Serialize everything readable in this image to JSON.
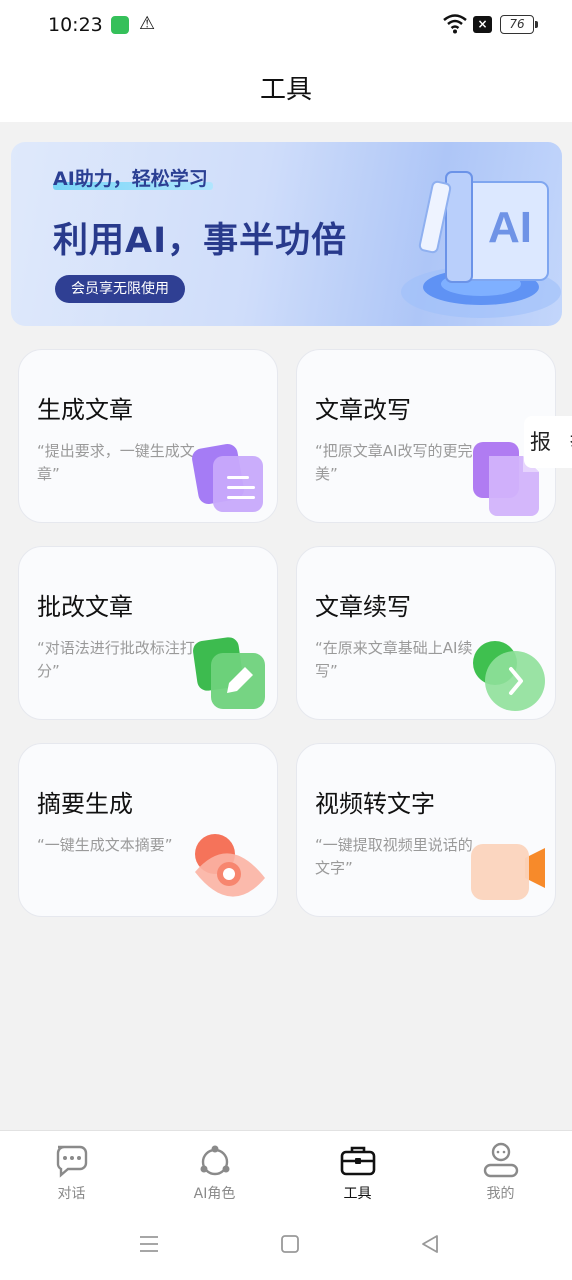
{
  "status_bar": {
    "time": "10:23",
    "battery": "76"
  },
  "header": {
    "title": "工具"
  },
  "banner": {
    "tagline": "AI助力，轻松学习",
    "headline": "利用AI，事半功倍",
    "button": "会员享无限使用"
  },
  "tools": [
    {
      "title": "生成文章",
      "desc": "“提出要求，一键生成文章”"
    },
    {
      "title": "文章改写",
      "desc": "“把原文章AI改写的更完美”"
    },
    {
      "title": "批改文章",
      "desc": "“对语法进行批改标注打分”"
    },
    {
      "title": "文章续写",
      "desc": "“在原来文章基础上AI续写”"
    },
    {
      "title": "摘要生成",
      "desc": "“一键生成文本摘要”"
    },
    {
      "title": "视频转文字",
      "desc": "“一键提取视频里说话的文字”"
    }
  ],
  "side_tab": {
    "label": "报 举"
  },
  "bottom_nav": [
    {
      "label": "对话"
    },
    {
      "label": "AI角色"
    },
    {
      "label": "工具"
    },
    {
      "label": "我的"
    }
  ],
  "colors": {
    "accent": "#2f3f93",
    "page_bg": "#f2f2f2"
  }
}
